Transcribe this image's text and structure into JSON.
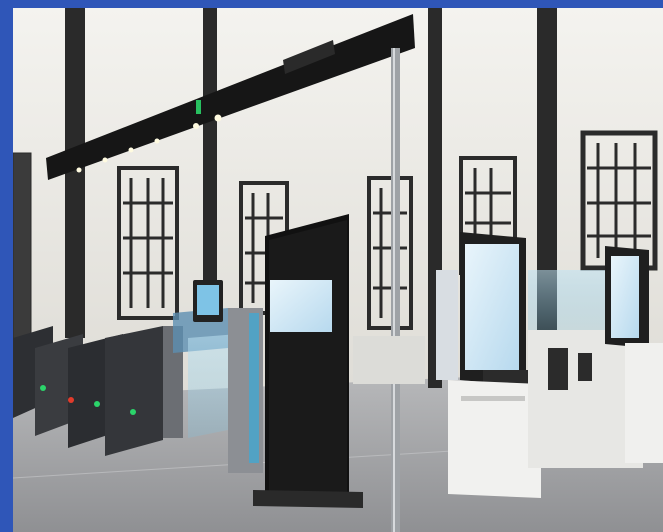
{
  "photo": {
    "sign_text": "",
    "colors": {
      "frame_border": "#2f56b8",
      "wall": "#ecebe7",
      "ceiling_beam": "#1c1c1c",
      "floor": "#a3a4a6",
      "kiosk_screen": "#cfe6f4",
      "gate_light_green": "#2bd46a",
      "gate_light_red": "#e23b2b",
      "accent_cyan": "#39a9d8"
    }
  }
}
